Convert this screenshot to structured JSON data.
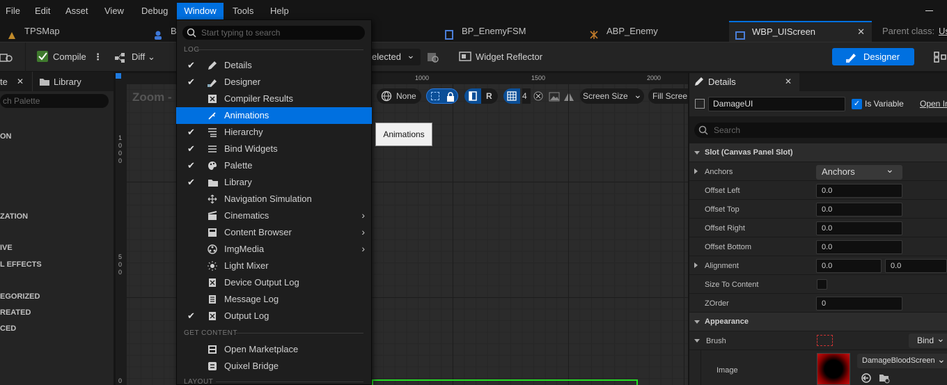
{
  "menubar": {
    "items": [
      "File",
      "Edit",
      "Asset",
      "View",
      "Debug",
      "Window",
      "Tools",
      "Help"
    ],
    "active": "Window"
  },
  "tabs": {
    "map": "TPSMap",
    "partial": "B",
    "enemy_fsm": "BP_EnemyFSM",
    "abp_enemy": "ABP_Enemy",
    "active": "WBP_UIScreen",
    "close": "✕",
    "parent_class_label": "Parent class:",
    "parent_class_value": "Us"
  },
  "toolbar": {
    "compile": "Compile",
    "diff": "Diff",
    "selected": "elected",
    "widget_reflector": "Widget Reflector",
    "designer": "Designer"
  },
  "palette": {
    "tab_partial": "te",
    "library": "Library",
    "search_placeholder": "ch Palette",
    "categories": [
      "ON",
      "ZATION",
      "IVE",
      "L EFFECTS",
      "EGORIZED",
      "REATED",
      "CED"
    ]
  },
  "viewport": {
    "zoom": "Zoom -",
    "ruler_top": [
      "1000",
      "1500",
      "2000"
    ],
    "ruler_left": [
      "1",
      "0",
      "0",
      "0",
      "5",
      "0",
      "0",
      "0"
    ],
    "none": "None",
    "r": "R",
    "grid_value": "4",
    "screen_size": "Screen Size",
    "fill_screen": "Fill Scree"
  },
  "window_menu": {
    "search_placeholder": "Start typing to search",
    "section_log": "LOG",
    "section_get_content": "GET CONTENT",
    "section_layout": "LAYOUT",
    "items": [
      {
        "label": "Details",
        "checked": true,
        "icon": "pencil-icon"
      },
      {
        "label": "Designer",
        "checked": true,
        "icon": "designer-brush-icon"
      },
      {
        "label": "Compiler Results",
        "checked": false,
        "icon": "compiler-icon"
      },
      {
        "label": "Animations",
        "checked": false,
        "icon": "animation-icon",
        "highlighted": true
      },
      {
        "label": "Hierarchy",
        "checked": true,
        "icon": "hierarchy-icon"
      },
      {
        "label": "Bind Widgets",
        "checked": true,
        "icon": "bind-widgets-icon"
      },
      {
        "label": "Palette",
        "checked": true,
        "icon": "palette-icon"
      },
      {
        "label": "Library",
        "checked": true,
        "icon": "folder-icon"
      },
      {
        "label": "Navigation Simulation",
        "checked": false,
        "icon": "navigation-icon"
      },
      {
        "label": "Cinematics",
        "checked": false,
        "icon": "cinematics-icon",
        "submenu": true
      },
      {
        "label": "Content Browser",
        "checked": false,
        "icon": "content-browser-icon",
        "submenu": true
      },
      {
        "label": "ImgMedia",
        "checked": false,
        "icon": "imgmedia-icon",
        "submenu": true
      },
      {
        "label": "Light Mixer",
        "checked": false,
        "icon": "light-icon"
      },
      {
        "label": "Device Output Log",
        "checked": false,
        "icon": "device-log-icon"
      },
      {
        "label": "Message Log",
        "checked": false,
        "icon": "message-log-icon"
      },
      {
        "label": "Output Log",
        "checked": true,
        "icon": "output-log-icon"
      }
    ],
    "content_items": [
      {
        "label": "Open Marketplace",
        "icon": "marketplace-icon"
      },
      {
        "label": "Quixel Bridge",
        "icon": "bridge-icon"
      }
    ],
    "tooltip": "Animations"
  },
  "details": {
    "tab": "Details",
    "name_value": "DamageUI",
    "is_variable": "Is Variable",
    "open_in": "Open In",
    "search_placeholder": "Search",
    "slot_section": "Slot (Canvas Panel Slot)",
    "anchors_label": "Anchors",
    "anchors_value": "Anchors",
    "offset_left": "Offset Left",
    "offset_left_value": "0.0",
    "offset_top": "Offset Top",
    "offset_top_value": "0.0",
    "offset_right": "Offset Right",
    "offset_right_value": "0.0",
    "offset_bottom": "Offset Bottom",
    "offset_bottom_value": "0.0",
    "alignment": "Alignment",
    "alignment_x": "0.0",
    "alignment_y": "0.0",
    "size_to_content": "Size To Content",
    "zorder": "ZOrder",
    "zorder_value": "0",
    "appearance_section": "Appearance",
    "brush": "Brush",
    "bind": "Bind",
    "image": "Image",
    "image_value": "DamageBloodScreen"
  },
  "colors": {
    "accent": "#0070e0",
    "menu_bg": "#1e1e1e",
    "panel_bg": "#242424",
    "green_frame": "#22dd22"
  }
}
